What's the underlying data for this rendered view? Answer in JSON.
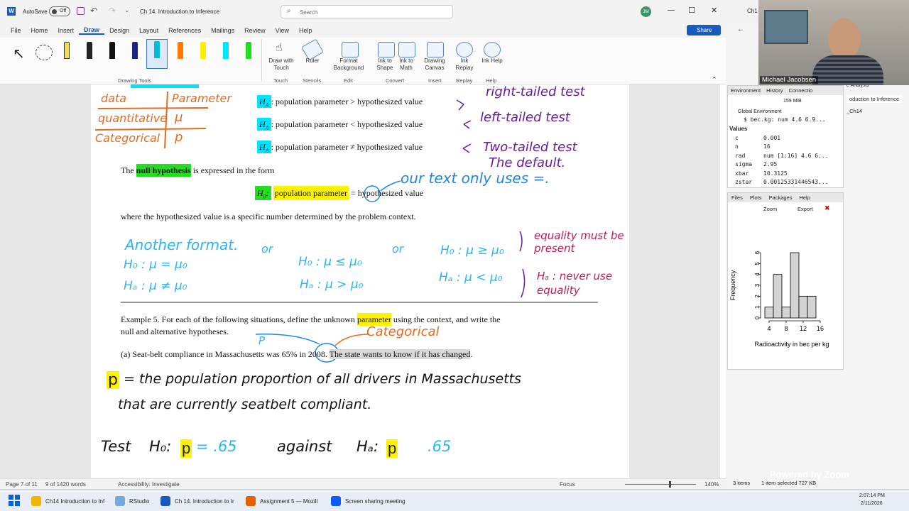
{
  "word": {
    "autosave": "AutoSave",
    "autosave_state": "Off",
    "doc_title": "Ch 14. Introduction to Inference",
    "search_placeholder": "Search",
    "user_initials": "JM",
    "tabs": [
      "File",
      "Home",
      "Insert",
      "Draw",
      "Design",
      "Layout",
      "References",
      "Mailings",
      "Review",
      "View",
      "Help"
    ],
    "share": "Share",
    "ribbon": {
      "group_drawing_tools": "Drawing Tools",
      "draw_with_touch": "Draw with Touch",
      "group_touch": "Touch",
      "ruler": "Ruler",
      "group_stencils": "Stencils",
      "format_background": "Format Background",
      "group_edit": "Edit",
      "ink_to_shape": "Ink to Shape",
      "ink_to_math": "Ink to Math",
      "group_convert": "Convert",
      "drawing_canvas": "Drawing Canvas",
      "group_insert": "Insert",
      "ink_replay": "Ink Replay",
      "group_replay": "Replay",
      "ink_help": "Ink Help",
      "group_help": "Help"
    },
    "status": {
      "page": "Page 7 of 11",
      "words": "9 of 1420 words",
      "accessibility": "Accessibility: Investigate",
      "focus": "Focus",
      "zoom": "140%"
    }
  },
  "document": {
    "ha1_label": "H",
    "ha_sub": "A",
    "ha1_text": ": population parameter > hypothesized value",
    "ha2_text": ": population parameter < hypothesized value",
    "ha3_text": ": population parameter ≠ hypothesized value",
    "null_pre": "The ",
    "null_hl": "null hypothesis",
    "null_post": " is expressed in the form",
    "h0_label": "H",
    "h0_sub": "0",
    "h0_param": "population parameter",
    "h0_eq": "=",
    "h0_post": " hypothesized value",
    "where_line": "where the hypothesized value is a specific number determined by the problem context.",
    "example_pre": "Example 5.  For each of the following situations, define the unknown ",
    "example_hl": "parameter",
    "example_post": " using the context, and write the",
    "example_line2": "null and alternative hypotheses.",
    "part_a_pre": "(a)  Seat-belt compliance in Massachusetts was ",
    "part_a_pct": "65%",
    "part_a_mid": " in 2008.  ",
    "part_a_hl": "The state wants to know if it has changed",
    "part_a_end": ".",
    "ink": {
      "table_col1": "data",
      "table_col2": "Parameter",
      "table_r1c1": "quantitative",
      "table_r1c2": "μ",
      "table_r2c1": "Categorical",
      "table_r2c2": "p",
      "right_tailed": "right-tailed test",
      "left_tailed": "left-tailed test",
      "two_tailed": "Two-tailed test",
      "the_default": "The default.",
      "our_text": "our text only uses =.",
      "another_format": "Another format.",
      "or1": "or",
      "or2": "or",
      "f1a": "H₀ : μ = μ₀",
      "f1b": "Hₐ : μ ≠ μ₀",
      "f2a": "H₀ : μ ≤ μ₀",
      "f2b": "Hₐ : μ > μ₀",
      "f3a": "H₀ : μ ≥ μ₀",
      "f3b": "Hₐ : μ < μ₀",
      "equality_must": "equality must be present",
      "ha_never": "Hₐ : never use equality",
      "p_ann": "P",
      "categorical_ann": "Categorical",
      "p_def1": "= the population proportion of all drivers in Massachusetts",
      "p_def2": "that are currently seatbelt compliant.",
      "p_letter": "p",
      "test_line": "Test",
      "h0_ink": "H₀:",
      "eq_65": "= .65",
      "against": "against",
      "ha_ink": "Hₐ:",
      "ne_65": ".65"
    }
  },
  "rstudio": {
    "tab_label": "Ch1",
    "analysis_tab": "e Analysis",
    "intro_tab": "oduction to Inference",
    "ch14_tab": "_Ch14",
    "env_tabs": [
      "Environment",
      "History",
      "Connectio"
    ],
    "mem": "159 MiB",
    "global_env": "Global Environment",
    "bec_line": "$ bec.kg: num  4.6 6.9...",
    "values_header": "Values",
    "values": [
      {
        "name": "c",
        "value": "0.001"
      },
      {
        "name": "n",
        "value": "16"
      },
      {
        "name": "rad",
        "value": "num [1:16] 4.6 6..."
      },
      {
        "name": "sigma",
        "value": "2.95"
      },
      {
        "name": "xbar",
        "value": "10.3125"
      },
      {
        "name": "zstar",
        "value": "0.00125331446543..."
      }
    ],
    "files_tabs": [
      "Files",
      "Plots",
      "Packages",
      "Help"
    ],
    "zoom": "Zoom",
    "export": "Export",
    "items": "3 items",
    "selected": "1 item selected  727 KB"
  },
  "chart_data": {
    "type": "bar",
    "title": "",
    "xlabel": "Radioactivity in bec per kg",
    "ylabel": "Frequency",
    "bins": [
      [
        3,
        5
      ],
      [
        5,
        7
      ],
      [
        7,
        9
      ],
      [
        9,
        11
      ],
      [
        11,
        13
      ],
      [
        13,
        15
      ],
      [
        15,
        17
      ]
    ],
    "values": [
      1,
      4,
      1,
      6,
      2,
      2,
      0
    ],
    "x_ticks": [
      4,
      8,
      12,
      16
    ],
    "y_ticks": [
      0,
      1,
      2,
      3,
      4,
      5,
      6
    ],
    "ylim": [
      0,
      6
    ]
  },
  "webcam": {
    "name": "Michael Jacobsen",
    "powered": "Powered by Zoom"
  },
  "taskbar": {
    "items": [
      "Ch14 Introduction to Inf",
      "RStudio",
      "Ch 14. Introduction to Ir",
      "Assignment 5 — Mozill",
      "Screen sharing meeting"
    ],
    "time": "2:07:14 PM",
    "date": "2/11/2026"
  }
}
